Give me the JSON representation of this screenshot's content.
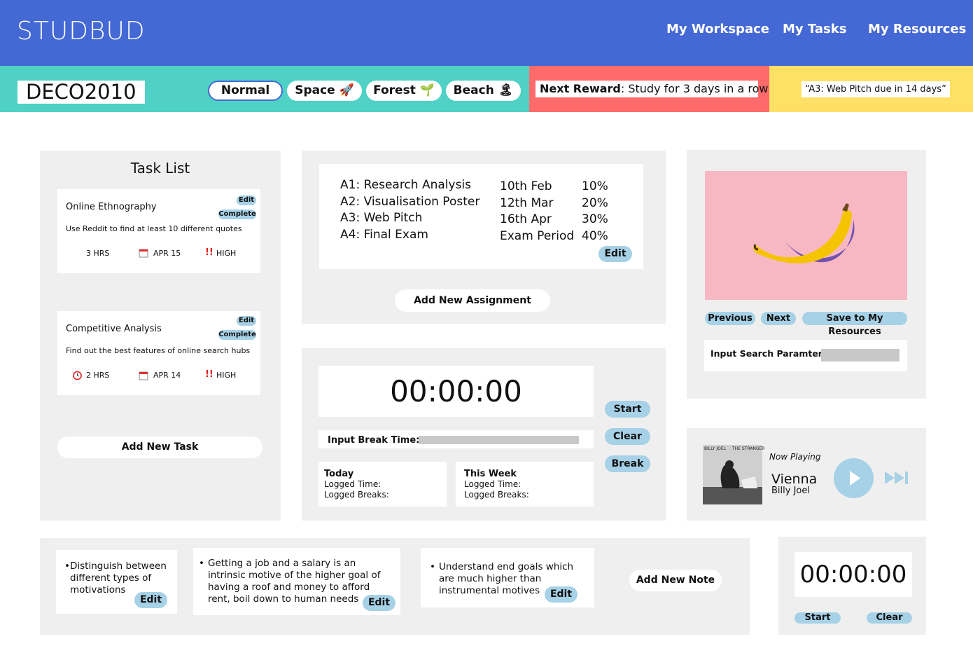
{
  "header": {
    "brand": "STUDBUD",
    "nav": [
      "My Workspace",
      "My Tasks",
      "My Resources"
    ]
  },
  "subbar": {
    "course": "DECO2010",
    "themes": [
      {
        "label": "Normal",
        "emoji": ""
      },
      {
        "label": "Space",
        "emoji": "🚀"
      },
      {
        "label": "Forest",
        "emoji": "🌱"
      },
      {
        "label": "Beach",
        "emoji": "🏝"
      }
    ],
    "active_theme": "Normal",
    "reward_label": "Next Reward",
    "reward_text": ": Study for 3 days in a row",
    "due_text": "“A3: Web Pitch due in 14 days”"
  },
  "tasks": {
    "title": "Task List",
    "edit_label": "Edit",
    "complete_label": "Complete",
    "items": [
      {
        "name": "Online Ethnography",
        "desc": "Use Reddit to find at least 10 different quotes",
        "hours": "3 HRS",
        "date": "APR 15",
        "priority": "HIGH"
      },
      {
        "name": "Competitive Analysis",
        "desc": "Find out the best features of online search hubs",
        "hours": "2 HRS",
        "date": "APR 14",
        "priority": "HIGH"
      }
    ],
    "add_label": "Add New Task"
  },
  "assignments": {
    "rows": [
      {
        "name": "A1: Research Analysis",
        "date": "10th Feb",
        "weight": "10%"
      },
      {
        "name": "A2: Visualisation Poster",
        "date": "12th Mar",
        "weight": "20%"
      },
      {
        "name": "A3: Web Pitch",
        "date": "16th Apr",
        "weight": "30%"
      },
      {
        "name": "A4: Final Exam",
        "date": "Exam Period",
        "weight": "40%"
      }
    ],
    "edit_label": "Edit",
    "add_label": "Add New Assignment"
  },
  "timer": {
    "display": "00:00:00",
    "start_label": "Start",
    "clear_label": "Clear",
    "break_label": "Break",
    "break_input_label": "Input Break Time:",
    "today_title": "Today",
    "week_title": "This Week",
    "logged_time": "Logged Time:",
    "logged_breaks": "Logged Breaks:"
  },
  "resources": {
    "image_color": "#f7b8c4",
    "previous_label": "Previous",
    "next_label": "Next",
    "save_label": "Save to My Resources",
    "search_label": "Input Search Paramter:"
  },
  "player": {
    "now_playing": "Now Playing",
    "track": "Vienna",
    "artist": "Billy Joel",
    "album_label_left": "BILLY JOEL",
    "album_label_right": "THE STRANGER"
  },
  "notes": {
    "items": [
      "Distinguish between different types of motivations",
      "Getting a job and a salary is an intrinsic motive of the higher goal of having a roof and money to afford rent, boil down to human needs",
      "Understand end goals which are much higher than instrumental motives"
    ],
    "edit_label": "Edit",
    "add_label": "Add New Note"
  },
  "mini_timer": {
    "display": "00:00:00",
    "start_label": "Start",
    "clear_label": "Clear"
  },
  "colors": {
    "header": "#4569d4",
    "teal": "#4fd1c5",
    "coral": "#ff6b6b",
    "yellow": "#ffe066",
    "button_blue": "#a6d1e6",
    "panel": "#efefef"
  }
}
